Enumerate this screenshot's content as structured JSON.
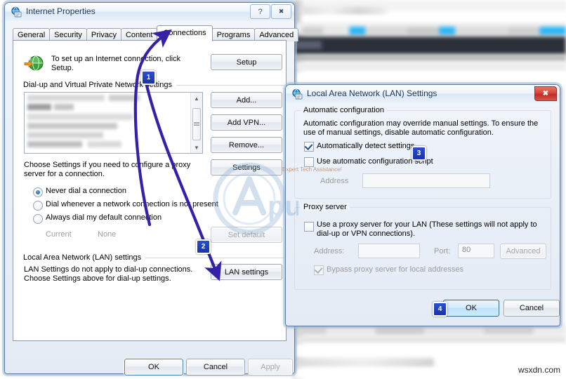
{
  "background": {
    "watermark_center_brand": "Appuals",
    "watermark_center_tagline": "Expert Tech Assistance!",
    "watermark_bottom": "wsxdn.com"
  },
  "internet_properties": {
    "title": "Internet Properties",
    "icon": "internet-properties-icon",
    "caption_buttons": [
      {
        "name": "help-button",
        "glyph": "?"
      },
      {
        "name": "close-button",
        "glyph": "✖"
      }
    ],
    "tabs": [
      {
        "label": "General",
        "active": false
      },
      {
        "label": "Security",
        "active": false
      },
      {
        "label": "Privacy",
        "active": false
      },
      {
        "label": "Content",
        "active": false
      },
      {
        "label": "Connections",
        "active": true
      },
      {
        "label": "Programs",
        "active": false
      },
      {
        "label": "Advanced",
        "active": false
      }
    ],
    "setup_section": {
      "icon": "globe-arrow-icon",
      "description_line1": "To set up an Internet connection, click",
      "description_line2": "Setup.",
      "setup_button": "Setup"
    },
    "dialup_section": {
      "header": "Dial-up and Virtual Private Network settings",
      "buttons": {
        "add": "Add...",
        "add_vpn": "Add VPN...",
        "remove": "Remove...",
        "settings": "Settings"
      },
      "hint_line1": "Choose Settings if you need to configure a proxy",
      "hint_line2": "server for a connection."
    },
    "dial_options": [
      {
        "label": "Never dial a connection",
        "selected": true
      },
      {
        "label": "Dial whenever a network connection is not present",
        "selected": false
      },
      {
        "label": "Always dial my default connection",
        "selected": false
      }
    ],
    "current_label": "Current",
    "current_value": "None",
    "set_default_button": "Set default",
    "lan_section": {
      "header": "Local Area Network (LAN) settings",
      "hint_line1": "LAN Settings do not apply to dial-up connections.",
      "hint_line2": "Choose Settings above for dial-up settings.",
      "lan_settings_button": "LAN settings"
    },
    "footer_buttons": {
      "ok": "OK",
      "cancel": "Cancel",
      "apply": "Apply"
    }
  },
  "lan_settings": {
    "title": "Local Area Network (LAN) Settings",
    "icon": "internet-properties-icon",
    "close_glyph": "✖",
    "automatic_configuration": {
      "group_title": "Automatic configuration",
      "description_line1": "Automatic configuration may override manual settings.  To ensure the",
      "description_line2": "use of manual settings, disable automatic configuration.",
      "auto_detect": {
        "label": "Automatically detect settings",
        "checked": true
      },
      "use_script": {
        "label": "Use automatic configuration script",
        "checked": false
      },
      "address_label": "Address",
      "address_value": ""
    },
    "proxy_server": {
      "group_title": "Proxy server",
      "use_proxy_line1": "Use a proxy server for your LAN (These settings will not apply to",
      "use_proxy_line2": "dial-up or VPN connections).",
      "use_proxy_checked": false,
      "address_label": "Address:",
      "address_value": "",
      "port_label": "Port:",
      "port_value": "80",
      "advanced_button": "Advanced",
      "bypass_label": "Bypass proxy server for local addresses",
      "bypass_checked": true
    },
    "footer_buttons": {
      "ok": "OK",
      "cancel": "Cancel"
    }
  },
  "annotations": {
    "badges": [
      {
        "number": "1",
        "target": "connections-tab"
      },
      {
        "number": "2",
        "target": "lan-settings-button"
      },
      {
        "number": "3",
        "target": "automatically-detect-settings-checkbox"
      },
      {
        "number": "4",
        "target": "lan-ok-button"
      }
    ],
    "arrow_color": "#3322a8"
  }
}
